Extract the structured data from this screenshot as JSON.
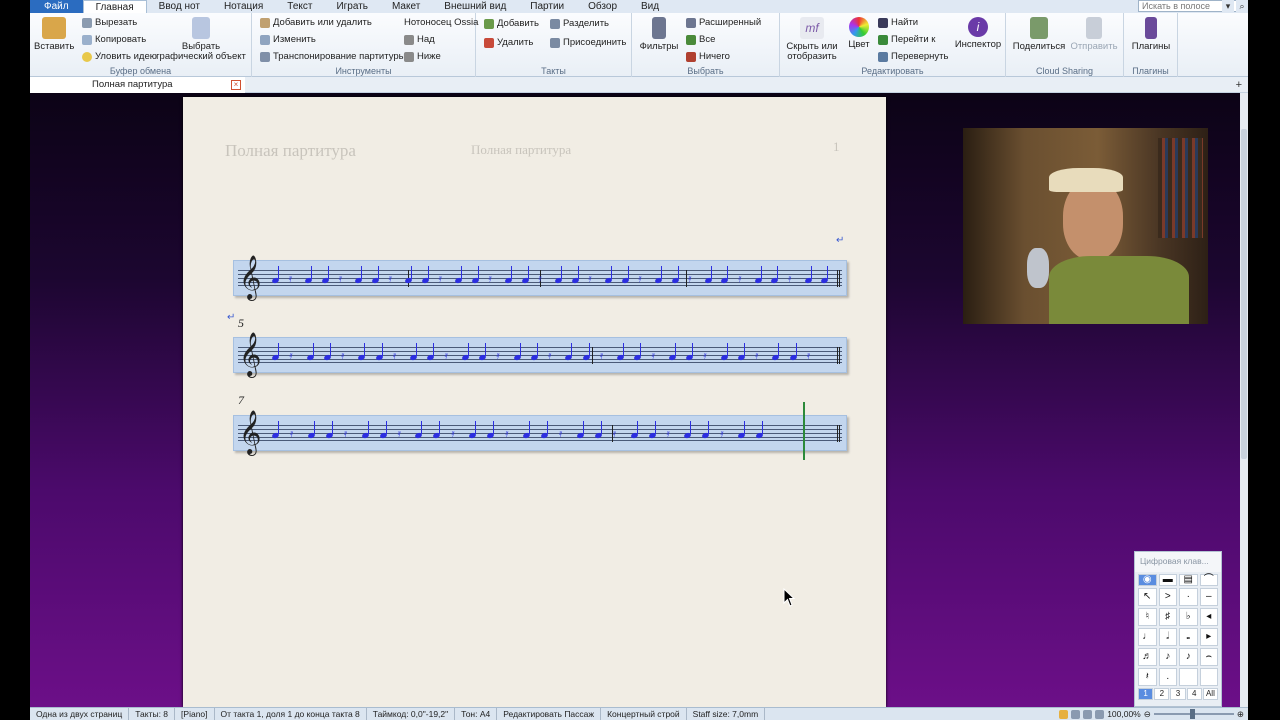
{
  "menubar": {
    "items": [
      "Файл",
      "Главная",
      "Ввод нот",
      "Нотация",
      "Текст",
      "Играть",
      "Макет",
      "Внешний вид",
      "Партии",
      "Обзор",
      "Вид"
    ],
    "active_index": 1,
    "search_placeholder": "Искать в полосе"
  },
  "ribbon": {
    "clipboard": {
      "label": "Буфер обмена",
      "paste": "Вставить",
      "cut": "Вырезать",
      "copy": "Копировать",
      "capture": "Уловить идею",
      "select_graphic": "Выбрать графический объект"
    },
    "instruments": {
      "label": "Инструменты",
      "add_remove": "Добавить или удалить",
      "change": "Изменить",
      "transpose": "Транспонирование партитуры",
      "ossia": "Нотоносец Ossia",
      "above": "Над",
      "below": "Ниже"
    },
    "bars": {
      "label": "Такты",
      "add": "Добавить",
      "delete": "Удалить",
      "split": "Разделить",
      "join": "Присоединить"
    },
    "select": {
      "label": "Выбрать",
      "filters": "Фильтры",
      "advanced": "Расширенный",
      "all": "Все",
      "none": "Ничего"
    },
    "edit": {
      "label": "Редактировать",
      "hide_show": "Скрыть или отобразить",
      "color": "Цвет",
      "find": "Найти",
      "goto": "Перейти к",
      "flip": "Перевернуть",
      "inspector": "Инспектор"
    },
    "cloud": {
      "label": "Cloud Sharing",
      "share": "Поделиться",
      "send": "Отправить"
    },
    "plugins": {
      "label": "Плагины",
      "plugins": "Плагины"
    }
  },
  "doc_tab": "Полная партитура",
  "page": {
    "title_left": "Полная партитура",
    "title_center": "Полная партитура",
    "page_number": "1",
    "system2_measure": "5",
    "system3_measure": "7"
  },
  "keypad": {
    "title": "Цифровая клав...",
    "tabs": [
      "1",
      "2",
      "3",
      "4",
      "All"
    ],
    "active_tab": 0
  },
  "status": {
    "pages": "Одна из двух страниц",
    "bars": "Такты: 8",
    "instrument": "[Piano]",
    "selection": "От такта 1, доля 1 до конца такта 8",
    "timecode": "Таймкод: 0,0\"-19,2\"",
    "pitch": "Тон: A4",
    "mode": "Редактировать Пассаж",
    "concert": "Концертный строй",
    "staff_size": "Staff size: 7,0mm",
    "zoom": "100,00%"
  }
}
